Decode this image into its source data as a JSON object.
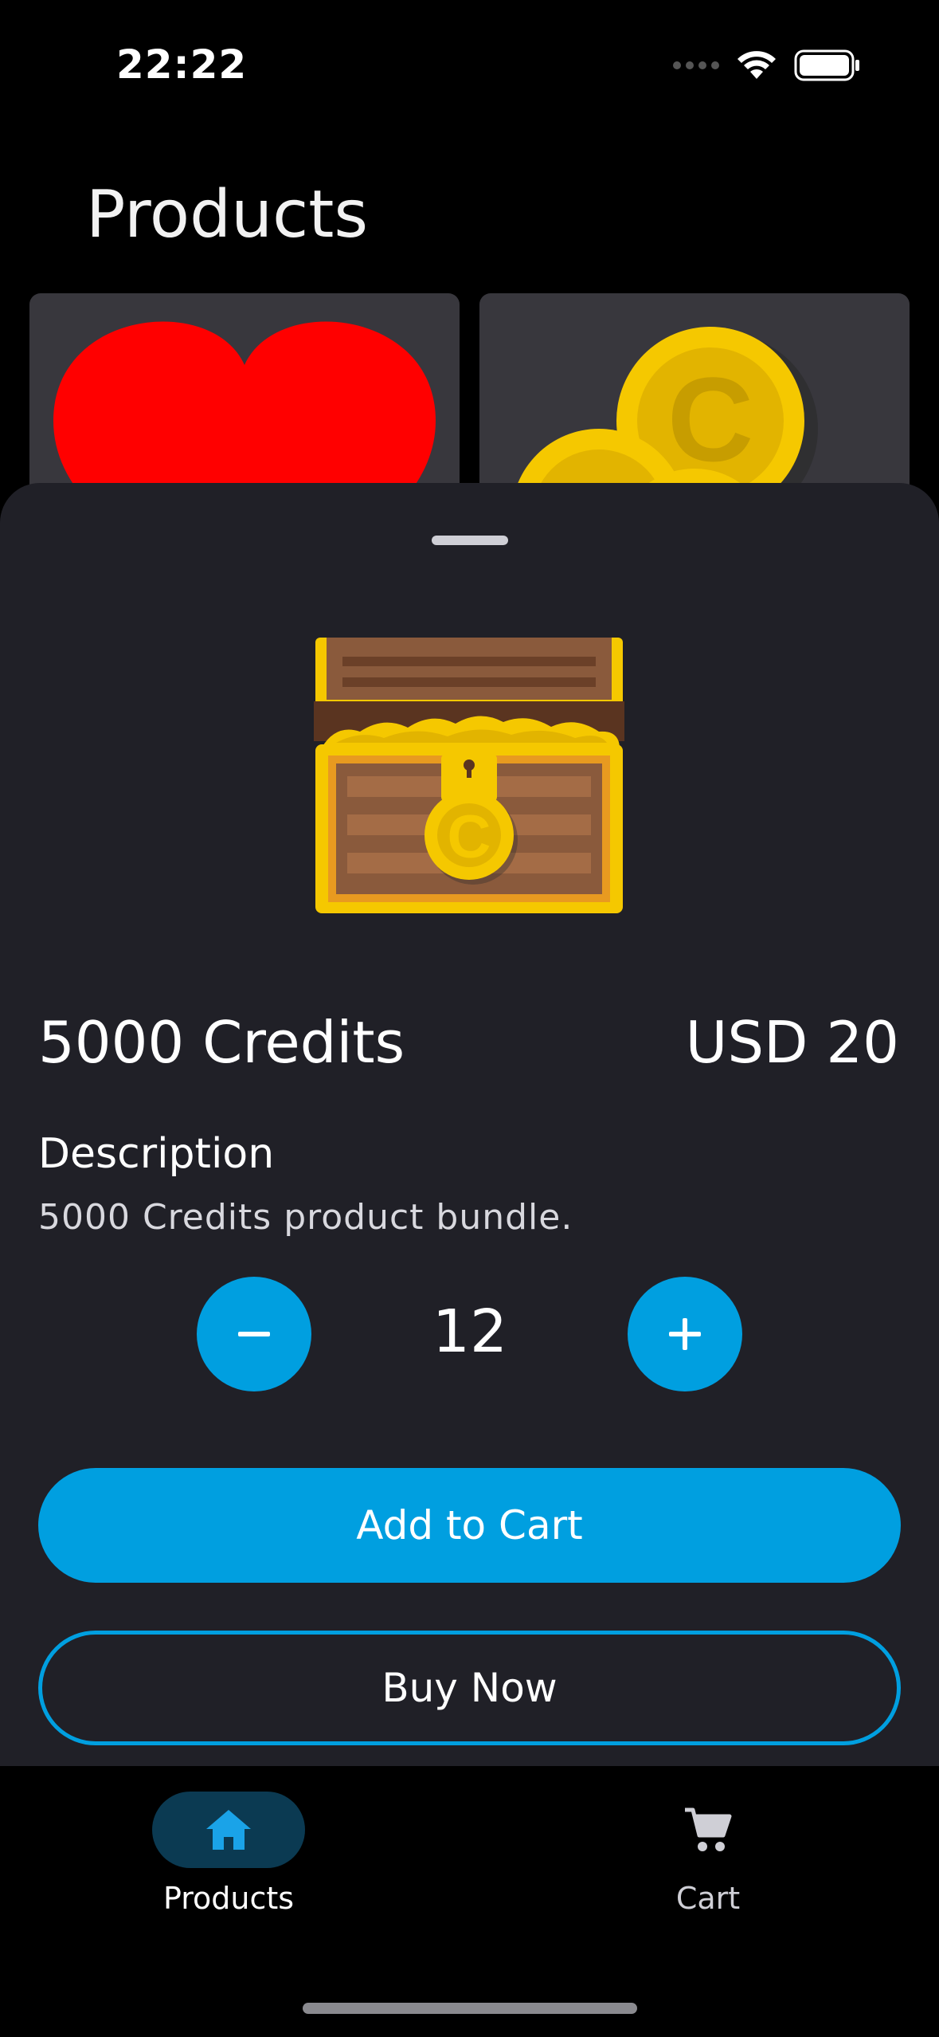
{
  "status_bar": {
    "time": "22:22"
  },
  "header": {
    "title": "Products"
  },
  "sheet": {
    "product_name": "5000 Credits",
    "price": "USD 20",
    "description_heading": "Description",
    "description_text": "5000 Credits product bundle.",
    "quantity": "12",
    "add_to_cart_label": "Add to Cart",
    "buy_now_label": "Buy Now"
  },
  "bottom_nav": {
    "items": [
      {
        "label": "Products",
        "icon": "home-icon",
        "active": true
      },
      {
        "label": "Cart",
        "icon": "cart-icon",
        "active": false
      }
    ]
  },
  "colors": {
    "accent": "#009fe0",
    "sheet_background": "#202027",
    "card_background": "#38373d",
    "nav_active_pill": "#0b3a52"
  }
}
